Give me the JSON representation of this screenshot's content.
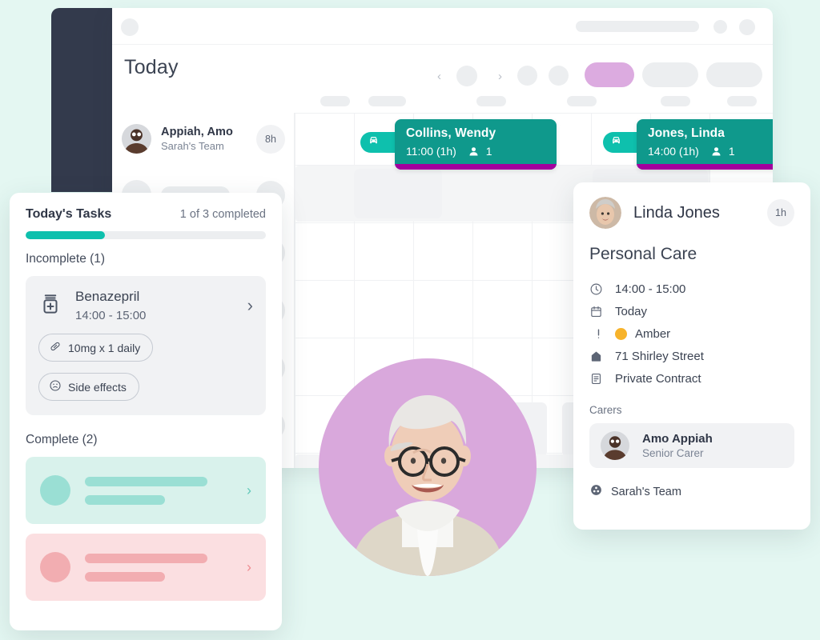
{
  "theme": {
    "page_bg": "#e4f7f2",
    "sidebar": "#333a4c",
    "teal": "#0f998c",
    "teal_bright": "#0ec0ad",
    "purple_strip": "#a3009e",
    "purple_pill": "#dcabe0",
    "photo_circle": "#d9a8dc",
    "amber": "#f7b32b",
    "skeleton": "#eceef0",
    "complete_green_bg": "#d9f2ec",
    "complete_green_fg": "#9adfd4",
    "complete_pink_bg": "#fbdfe1",
    "complete_pink_fg": "#f2adb1"
  },
  "app_window": {
    "page_title": "Today",
    "nav": {
      "prev_label": "‹",
      "next_label": "›"
    },
    "calendar": {
      "rows": [
        {
          "name": "Appiah, Amo",
          "team": "Sarah's Team",
          "hours": "8h",
          "appointments": [
            {
              "client": "Collins, Wendy",
              "time": "11:00 (1h)",
              "people": "1",
              "travel_icon": "car-icon"
            },
            {
              "client": "Jones, Linda",
              "time": "14:00 (1h)",
              "people": "1",
              "travel_icon": "car-icon"
            }
          ]
        }
      ]
    }
  },
  "tasks_card": {
    "title": "Today's Tasks",
    "count_label": "1 of 3 completed",
    "progress_percent": 33,
    "incomplete_label": "Incomplete (1)",
    "incomplete": [
      {
        "icon": "medication-icon",
        "name": "Benazepril",
        "time": "14:00 - 15:00",
        "chevron": "›",
        "chips": [
          {
            "icon": "pill-icon",
            "label": "10mg x 1 daily"
          },
          {
            "icon": "sad-face-icon",
            "label": "Side effects"
          }
        ]
      }
    ],
    "complete_label": "Complete (2)",
    "complete": [
      {
        "variant": "green",
        "chevron": "›"
      },
      {
        "variant": "pink",
        "chevron": "›"
      }
    ]
  },
  "detail_card": {
    "client_name": "Linda Jones",
    "duration": "1h",
    "visit_type": "Personal Care",
    "details": [
      {
        "icon": "clock-icon",
        "value": "14:00 - 15:00"
      },
      {
        "icon": "calendar-icon",
        "value": "Today"
      },
      {
        "icon": "alert-icon",
        "value": "Amber",
        "dot_color": "#f7b32b"
      },
      {
        "icon": "home-icon",
        "value": "71 Shirley Street"
      },
      {
        "icon": "document-icon",
        "value": "Private Contract"
      }
    ],
    "carers_label": "Carers",
    "carers": [
      {
        "name": "Amo Appiah",
        "role": "Senior Carer"
      }
    ],
    "team": {
      "icon": "team-icon",
      "label": "Sarah's Team"
    }
  }
}
